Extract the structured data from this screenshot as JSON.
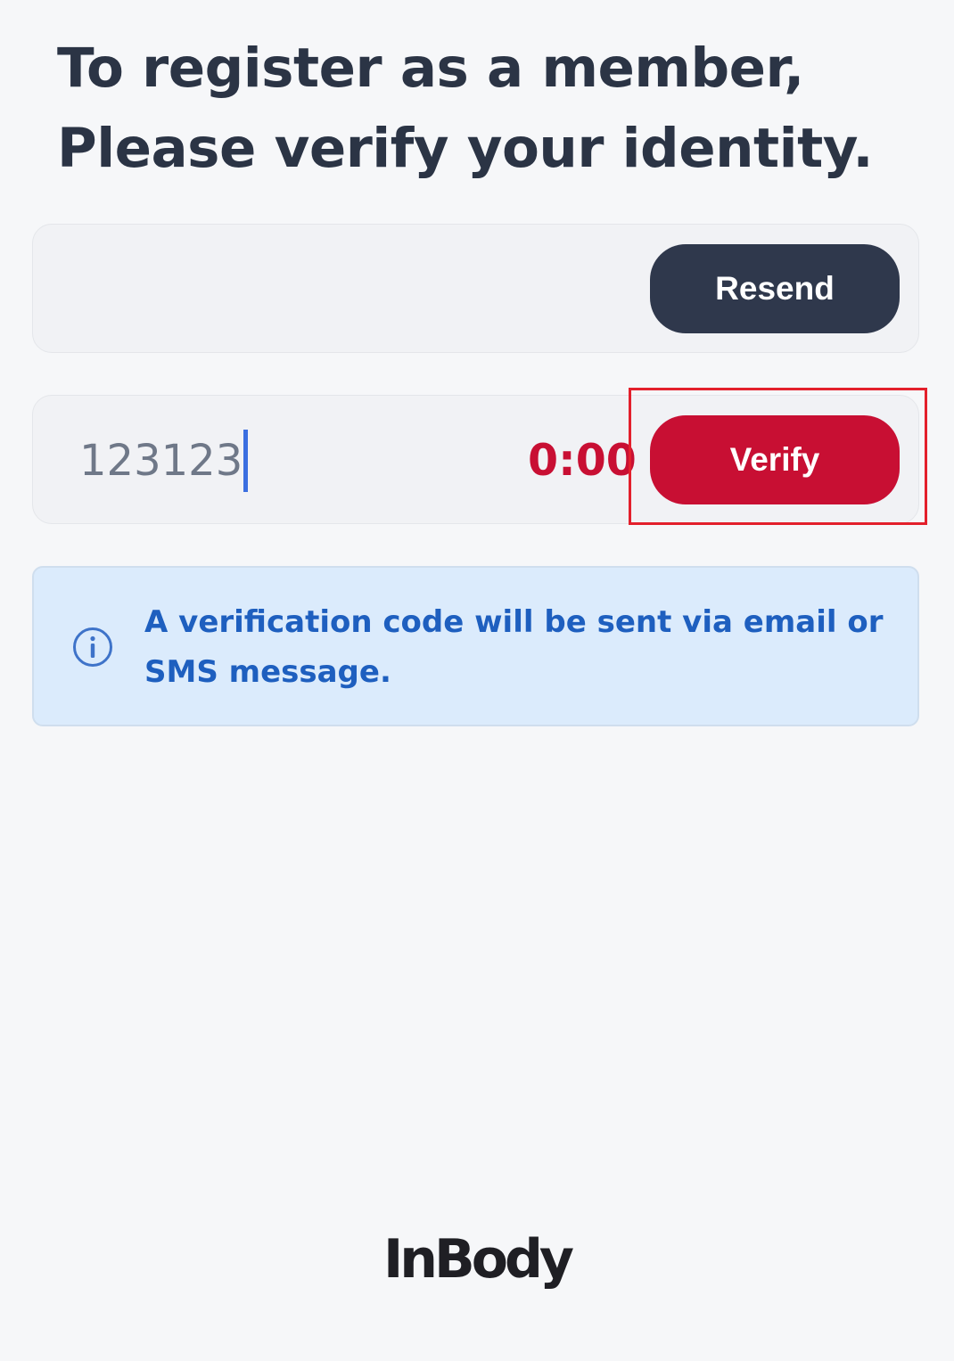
{
  "header": {
    "title_line1": "To register as a member,",
    "title_line2": "Please verify your identity."
  },
  "resend_row": {
    "resend_label": "Resend"
  },
  "code_row": {
    "code_value": "123123",
    "timer": "0:00",
    "verify_label": "Verify"
  },
  "notice": {
    "icon": "info-icon",
    "text": "A verification code will be sent via email or SMS message."
  },
  "footer": {
    "logo_text": "InBody"
  },
  "colors": {
    "background": "#f6f7f9",
    "heading": "#2b3445",
    "resend_button": "#2f384c",
    "verify_button": "#c80f33",
    "timer": "#c80f33",
    "notice_background": "#dbebfc",
    "notice_text": "#1e5fbf",
    "highlight_box": "#e3202c"
  }
}
